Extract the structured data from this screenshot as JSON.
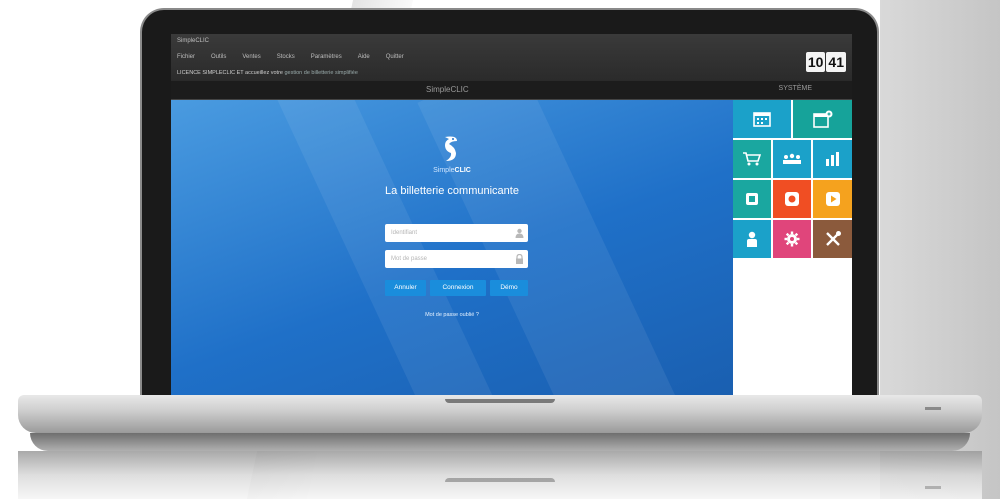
{
  "window": {
    "small_title": "SimpleCLIC",
    "menu": [
      "Fichier",
      "Outils",
      "Ventes",
      "Stocks",
      "Paramètres",
      "Aide",
      "Quitter"
    ],
    "status_text": "LICENCE SIMPLECLIC ET accueillez votre",
    "status_hint": "gestion de billetterie simplifiée",
    "clock_hour": "10",
    "clock_min": "41"
  },
  "titlebar": {
    "app_title": "SimpleCLIC",
    "systems_tab": "SYSTÈME"
  },
  "login": {
    "brand_prefix": "Simple",
    "brand_suffix": "CLIC",
    "tagline": "La billetterie communicante",
    "username_placeholder": "Identifiant",
    "password_placeholder": "Mot de passe",
    "cancel_label": "Annuler",
    "connect_label": "Connexion",
    "demo_label": "Démo",
    "forgot_label": "Mot de passe oublié ?"
  },
  "tiles": [
    {
      "icon": "calendar-icon",
      "color": "#1ba1c9"
    },
    {
      "icon": "calendar-add-icon",
      "color": "#16a39a"
    },
    {
      "icon": "cart-icon",
      "color": "#1aa7a0"
    },
    {
      "icon": "audience-icon",
      "color": "#1ba1c9"
    },
    {
      "icon": "bar-chart-icon",
      "color": "#1ba1c9"
    },
    {
      "icon": "ticket-icon",
      "color": "#1aa7a0"
    },
    {
      "icon": "print-icon",
      "color": "#f04e23"
    },
    {
      "icon": "media-icon",
      "color": "#f5a21e"
    },
    {
      "icon": "user-icon",
      "color": "#1ba1c9"
    },
    {
      "icon": "gear-icon",
      "color": "#e0457b"
    },
    {
      "icon": "tools-icon",
      "color": "#8b5a3c"
    }
  ]
}
